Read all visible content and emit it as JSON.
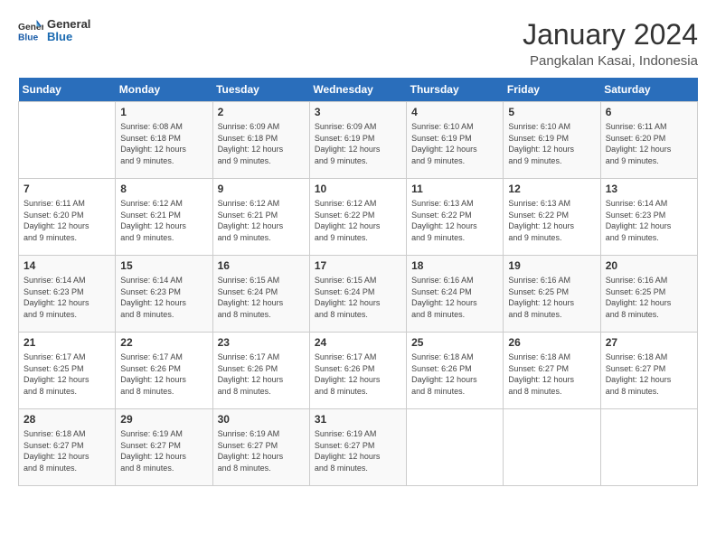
{
  "header": {
    "logo": {
      "line1": "General",
      "line2": "Blue"
    },
    "month_year": "January 2024",
    "location": "Pangkalan Kasai, Indonesia"
  },
  "days_of_week": [
    "Sunday",
    "Monday",
    "Tuesday",
    "Wednesday",
    "Thursday",
    "Friday",
    "Saturday"
  ],
  "weeks": [
    [
      {
        "day": "",
        "info": ""
      },
      {
        "day": "1",
        "info": "Sunrise: 6:08 AM\nSunset: 6:18 PM\nDaylight: 12 hours\nand 9 minutes."
      },
      {
        "day": "2",
        "info": "Sunrise: 6:09 AM\nSunset: 6:18 PM\nDaylight: 12 hours\nand 9 minutes."
      },
      {
        "day": "3",
        "info": "Sunrise: 6:09 AM\nSunset: 6:19 PM\nDaylight: 12 hours\nand 9 minutes."
      },
      {
        "day": "4",
        "info": "Sunrise: 6:10 AM\nSunset: 6:19 PM\nDaylight: 12 hours\nand 9 minutes."
      },
      {
        "day": "5",
        "info": "Sunrise: 6:10 AM\nSunset: 6:19 PM\nDaylight: 12 hours\nand 9 minutes."
      },
      {
        "day": "6",
        "info": "Sunrise: 6:11 AM\nSunset: 6:20 PM\nDaylight: 12 hours\nand 9 minutes."
      }
    ],
    [
      {
        "day": "7",
        "info": "Sunrise: 6:11 AM\nSunset: 6:20 PM\nDaylight: 12 hours\nand 9 minutes."
      },
      {
        "day": "8",
        "info": "Sunrise: 6:12 AM\nSunset: 6:21 PM\nDaylight: 12 hours\nand 9 minutes."
      },
      {
        "day": "9",
        "info": "Sunrise: 6:12 AM\nSunset: 6:21 PM\nDaylight: 12 hours\nand 9 minutes."
      },
      {
        "day": "10",
        "info": "Sunrise: 6:12 AM\nSunset: 6:22 PM\nDaylight: 12 hours\nand 9 minutes."
      },
      {
        "day": "11",
        "info": "Sunrise: 6:13 AM\nSunset: 6:22 PM\nDaylight: 12 hours\nand 9 minutes."
      },
      {
        "day": "12",
        "info": "Sunrise: 6:13 AM\nSunset: 6:22 PM\nDaylight: 12 hours\nand 9 minutes."
      },
      {
        "day": "13",
        "info": "Sunrise: 6:14 AM\nSunset: 6:23 PM\nDaylight: 12 hours\nand 9 minutes."
      }
    ],
    [
      {
        "day": "14",
        "info": "Sunrise: 6:14 AM\nSunset: 6:23 PM\nDaylight: 12 hours\nand 9 minutes."
      },
      {
        "day": "15",
        "info": "Sunrise: 6:14 AM\nSunset: 6:23 PM\nDaylight: 12 hours\nand 8 minutes."
      },
      {
        "day": "16",
        "info": "Sunrise: 6:15 AM\nSunset: 6:24 PM\nDaylight: 12 hours\nand 8 minutes."
      },
      {
        "day": "17",
        "info": "Sunrise: 6:15 AM\nSunset: 6:24 PM\nDaylight: 12 hours\nand 8 minutes."
      },
      {
        "day": "18",
        "info": "Sunrise: 6:16 AM\nSunset: 6:24 PM\nDaylight: 12 hours\nand 8 minutes."
      },
      {
        "day": "19",
        "info": "Sunrise: 6:16 AM\nSunset: 6:25 PM\nDaylight: 12 hours\nand 8 minutes."
      },
      {
        "day": "20",
        "info": "Sunrise: 6:16 AM\nSunset: 6:25 PM\nDaylight: 12 hours\nand 8 minutes."
      }
    ],
    [
      {
        "day": "21",
        "info": "Sunrise: 6:17 AM\nSunset: 6:25 PM\nDaylight: 12 hours\nand 8 minutes."
      },
      {
        "day": "22",
        "info": "Sunrise: 6:17 AM\nSunset: 6:26 PM\nDaylight: 12 hours\nand 8 minutes."
      },
      {
        "day": "23",
        "info": "Sunrise: 6:17 AM\nSunset: 6:26 PM\nDaylight: 12 hours\nand 8 minutes."
      },
      {
        "day": "24",
        "info": "Sunrise: 6:17 AM\nSunset: 6:26 PM\nDaylight: 12 hours\nand 8 minutes."
      },
      {
        "day": "25",
        "info": "Sunrise: 6:18 AM\nSunset: 6:26 PM\nDaylight: 12 hours\nand 8 minutes."
      },
      {
        "day": "26",
        "info": "Sunrise: 6:18 AM\nSunset: 6:27 PM\nDaylight: 12 hours\nand 8 minutes."
      },
      {
        "day": "27",
        "info": "Sunrise: 6:18 AM\nSunset: 6:27 PM\nDaylight: 12 hours\nand 8 minutes."
      }
    ],
    [
      {
        "day": "28",
        "info": "Sunrise: 6:18 AM\nSunset: 6:27 PM\nDaylight: 12 hours\nand 8 minutes."
      },
      {
        "day": "29",
        "info": "Sunrise: 6:19 AM\nSunset: 6:27 PM\nDaylight: 12 hours\nand 8 minutes."
      },
      {
        "day": "30",
        "info": "Sunrise: 6:19 AM\nSunset: 6:27 PM\nDaylight: 12 hours\nand 8 minutes."
      },
      {
        "day": "31",
        "info": "Sunrise: 6:19 AM\nSunset: 6:27 PM\nDaylight: 12 hours\nand 8 minutes."
      },
      {
        "day": "",
        "info": ""
      },
      {
        "day": "",
        "info": ""
      },
      {
        "day": "",
        "info": ""
      }
    ]
  ]
}
